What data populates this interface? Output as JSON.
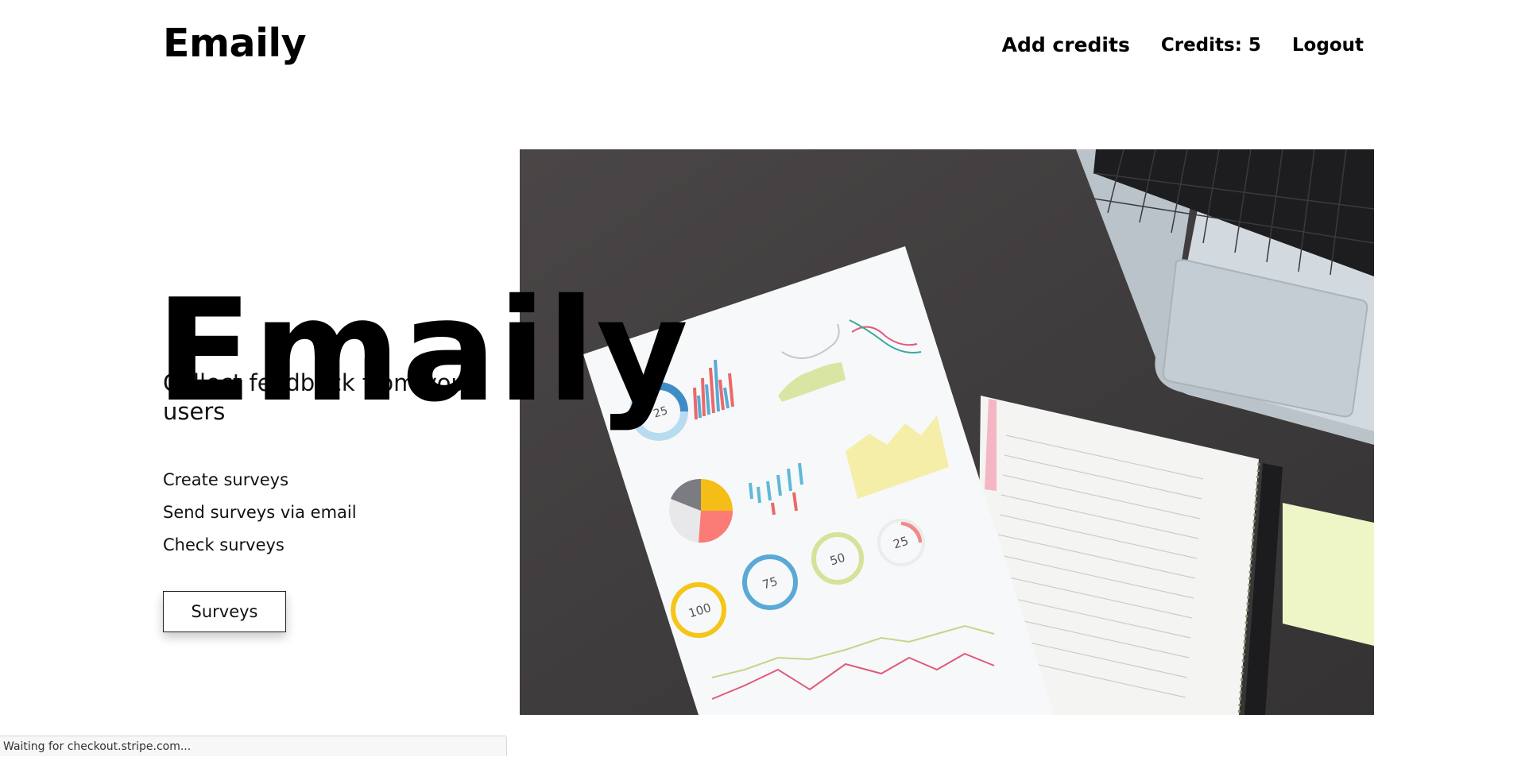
{
  "header": {
    "brand": "Emaily",
    "links": {
      "add_credits": "Add credits",
      "credits": "Credits: 5",
      "logout": "Logout"
    }
  },
  "hero": {
    "title": "Emaily",
    "subtitle": "Collect feedback from your users",
    "features": [
      "Create surveys",
      "Send surveys via email",
      "Check surveys"
    ],
    "button_label": "Surveys",
    "image": {
      "chart_numbers": [
        "25",
        "100",
        "75",
        "50",
        "25"
      ]
    }
  },
  "status_bar": {
    "text": "Waiting for checkout.stripe.com..."
  },
  "colors": {
    "background": "#ffffff",
    "text": "#000000",
    "desk": "#3d3b3c",
    "laptop": "#cfd8dd",
    "sticky_note": "#eef6c8"
  }
}
